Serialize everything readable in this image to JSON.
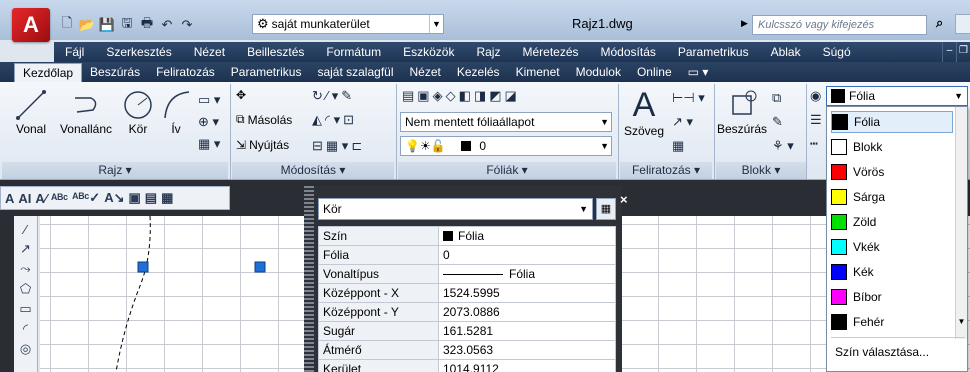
{
  "title": {
    "workspace": "saját munkaterület",
    "document": "Rajz1.dwg",
    "search_placeholder": "Kulcsszó vagy kifejezés"
  },
  "menu": [
    "Fájl",
    "Szerkesztés",
    "Nézet",
    "Beillesztés",
    "Formátum",
    "Eszközök",
    "Rajz",
    "Méretezés",
    "Módosítás",
    "Parametrikus",
    "Ablak",
    "Súgó"
  ],
  "ribbon_tabs": [
    {
      "label": "Kezdőlap",
      "active": true
    },
    {
      "label": "Beszúrás"
    },
    {
      "label": "Feliratozás"
    },
    {
      "label": "Parametrikus"
    },
    {
      "label": "saját szalagfül"
    },
    {
      "label": "Nézet"
    },
    {
      "label": "Kezelés"
    },
    {
      "label": "Kimenet"
    },
    {
      "label": "Modulok"
    },
    {
      "label": "Online"
    }
  ],
  "panels": {
    "rajz": {
      "title": "Rajz",
      "tools": {
        "vonal": "Vonal",
        "vonallanc": "Vonallánc",
        "kor": "Kör",
        "iv": "Ív"
      }
    },
    "modositas": {
      "title": "Módosítás",
      "masolas": "Másolás",
      "nyujtas": "Nyújtás"
    },
    "foliak": {
      "title": "Fóliák",
      "state_combo": "Nem mentett fóliaállapot",
      "layer_combo": "0"
    },
    "feliratozas": {
      "title": "Feliratozás",
      "szoveg": "Szöveg"
    },
    "blokk": {
      "title": "Blokk",
      "beszuras": "Beszúrás"
    }
  },
  "color_dropdown": {
    "current": "Fólia",
    "items": [
      {
        "label": "Fólia",
        "color": "#000000",
        "selected": true
      },
      {
        "label": "Blokk",
        "color": "#ffffff"
      },
      {
        "label": "Vörös",
        "color": "#ff0000"
      },
      {
        "label": "Sárga",
        "color": "#ffff00"
      },
      {
        "label": "Zöld",
        "color": "#00e000"
      },
      {
        "label": "Vkék",
        "color": "#00ffff"
      },
      {
        "label": "Kék",
        "color": "#0000ff"
      },
      {
        "label": "Bíbor",
        "color": "#ff00ff"
      },
      {
        "label": "Fehér",
        "color": "#000000"
      }
    ],
    "choose_label": "Szín választása..."
  },
  "properties": {
    "object": "Kör",
    "rows": [
      {
        "label": "Szín",
        "value": "Fólia",
        "kind": "swatch"
      },
      {
        "label": "Fólia",
        "value": "0"
      },
      {
        "label": "Vonaltípus",
        "value": "Fólia",
        "kind": "line"
      },
      {
        "label": "Középpont - X",
        "value": "1524.5995"
      },
      {
        "label": "Középpont - Y",
        "value": "2073.0886"
      },
      {
        "label": "Sugár",
        "value": "161.5281"
      },
      {
        "label": "Átmérő",
        "value": "323.0563"
      },
      {
        "label": "Kerület",
        "value": "1014.9112"
      }
    ]
  },
  "colors": {
    "grip_blue": "#1f6fd6",
    "accent": "#e6282a"
  }
}
